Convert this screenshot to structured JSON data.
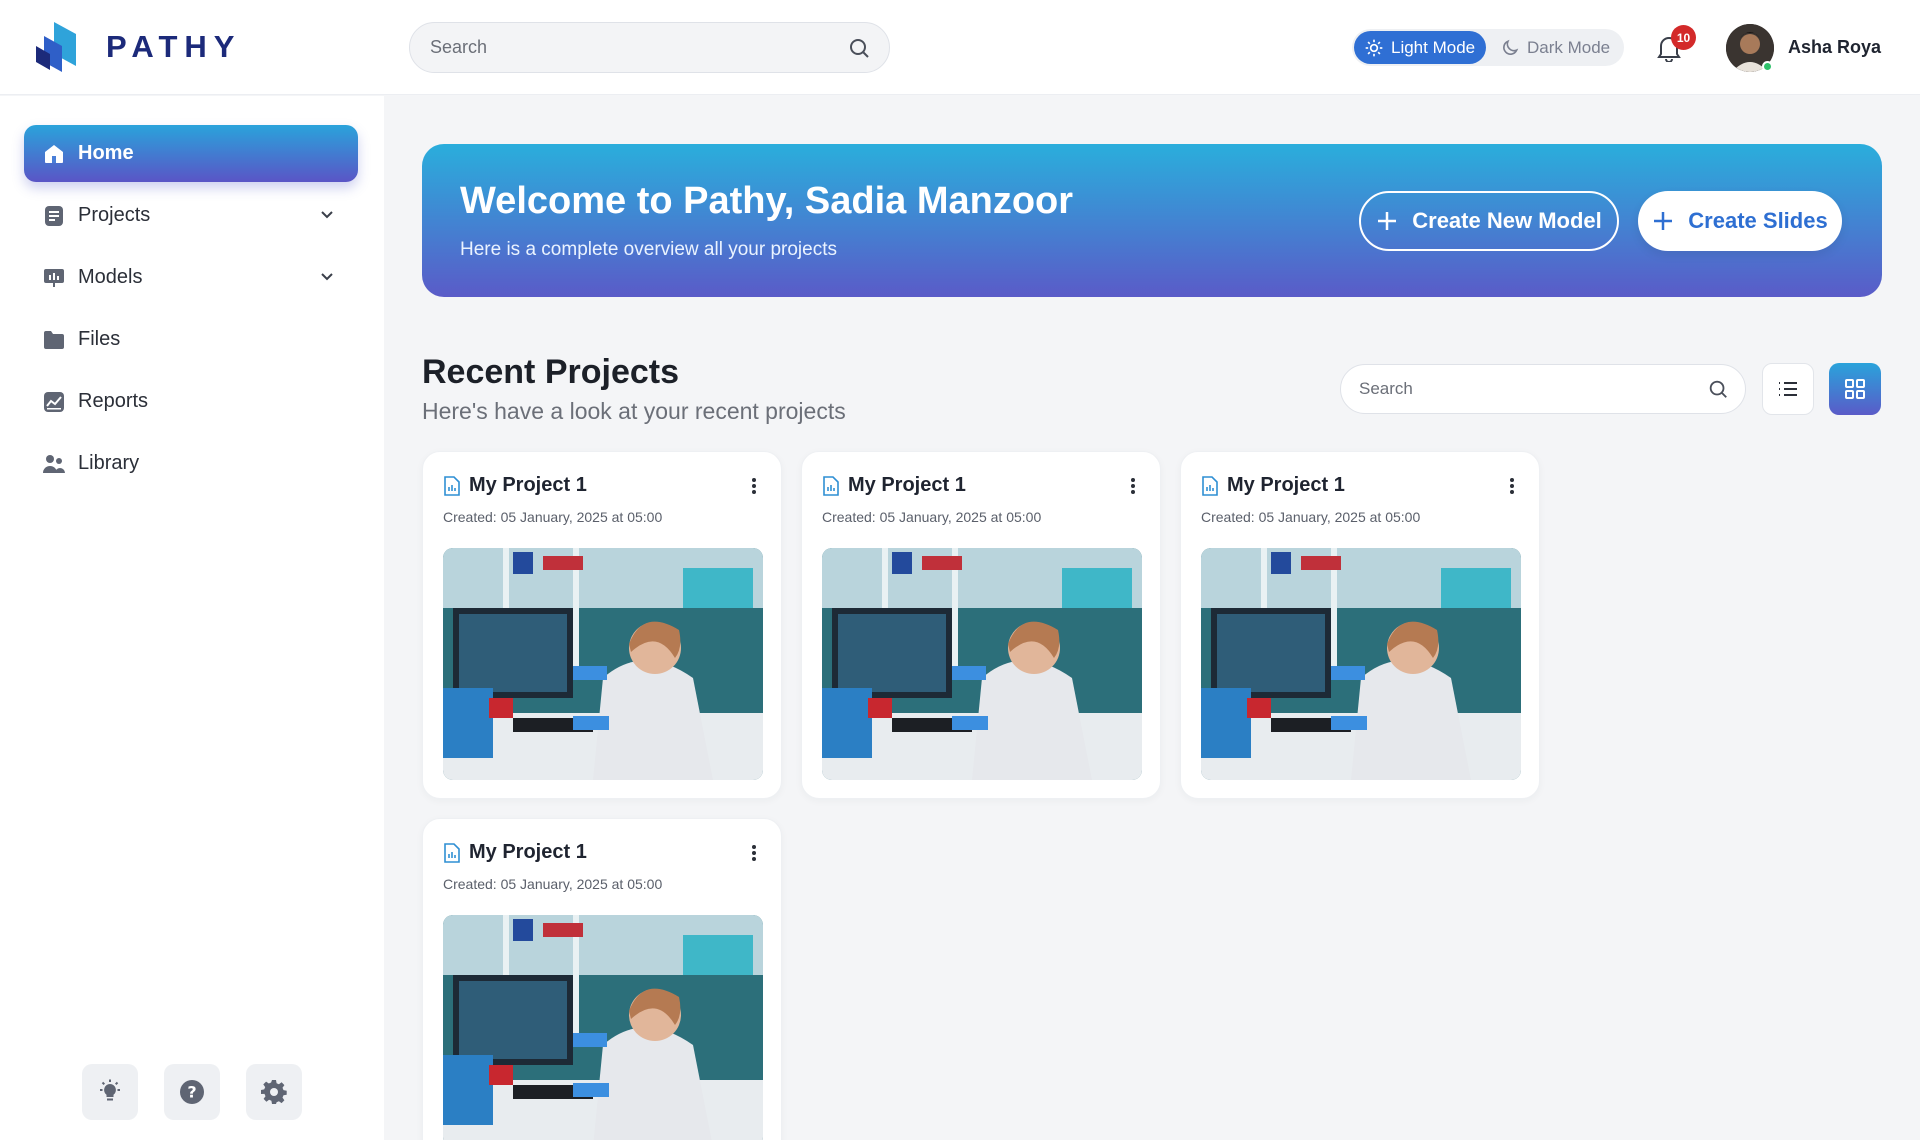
{
  "brand": {
    "name": "PATHY"
  },
  "search": {
    "placeholder": "Search"
  },
  "mode": {
    "light_label": "Light Mode",
    "dark_label": "Dark Mode",
    "active": "light"
  },
  "notifications": {
    "count": "10"
  },
  "user": {
    "name": "Asha Roya",
    "status": "online"
  },
  "sidebar": {
    "items": [
      {
        "label": "Home",
        "icon": "home-icon",
        "active": true
      },
      {
        "label": "Projects",
        "icon": "document-icon",
        "expandable": true
      },
      {
        "label": "Models",
        "icon": "presentation-icon",
        "expandable": true
      },
      {
        "label": "Files",
        "icon": "folder-icon"
      },
      {
        "label": "Reports",
        "icon": "chart-report-icon"
      },
      {
        "label": "Library",
        "icon": "people-icon"
      }
    ],
    "tools": [
      "lightbulb-icon",
      "help-icon",
      "settings-icon"
    ]
  },
  "banner": {
    "title": "Welcome to Pathy, Sadia Manzoor",
    "subtitle": "Here is a complete overview all your projects",
    "create_model": "Create New Model",
    "create_slides": "Create Slides"
  },
  "recent": {
    "title": "Recent Projects",
    "subtitle": "Here's have a look at your recent projects",
    "search_placeholder": "Search",
    "view": "grid",
    "projects": [
      {
        "title": "My Project 1",
        "created": "Created: 05 January, 2025 at 05:00"
      },
      {
        "title": "My Project 1",
        "created": "Created: 05 January, 2025 at 05:00"
      },
      {
        "title": "My Project 1",
        "created": "Created: 05 January, 2025 at 05:00"
      },
      {
        "title": "My Project 1",
        "created": "Created: 05 January, 2025 at 05:00"
      }
    ]
  },
  "colors": {
    "accent": "#2f6fd4",
    "gradient_start": "#2aaedc",
    "gradient_end": "#5a5bc8",
    "badge": "#d32a2a",
    "online": "#2fc16a"
  }
}
